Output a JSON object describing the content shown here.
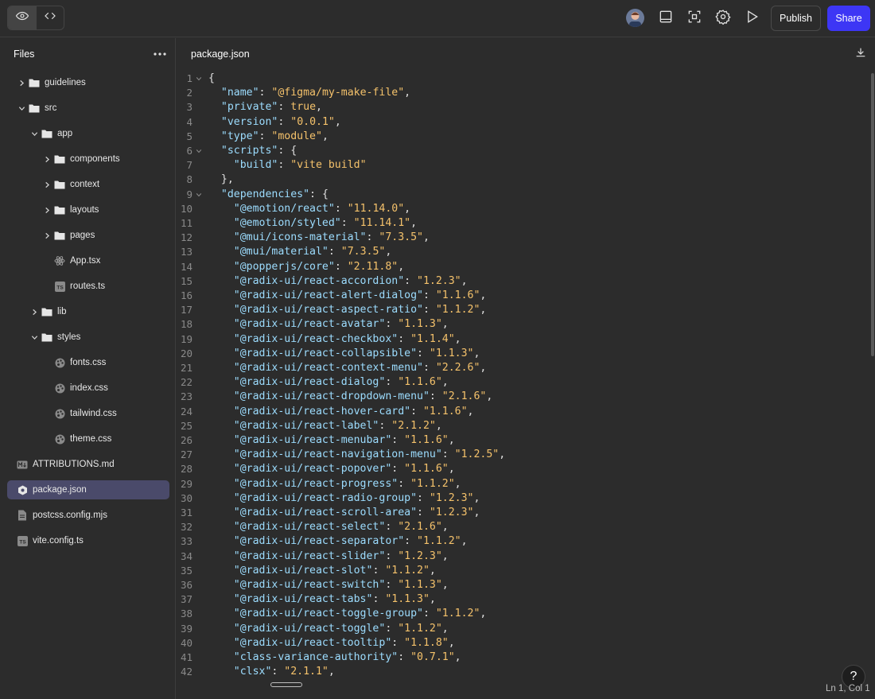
{
  "toolbar": {
    "publish_label": "Publish",
    "share_label": "Share"
  },
  "sidebar": {
    "title": "Files",
    "items": [
      {
        "label": "guidelines",
        "type": "folder",
        "depth": 1,
        "expanded": false
      },
      {
        "label": "src",
        "type": "folder",
        "depth": 1,
        "expanded": true
      },
      {
        "label": "app",
        "type": "folder",
        "depth": 2,
        "expanded": true
      },
      {
        "label": "components",
        "type": "folder",
        "depth": 3,
        "expanded": false
      },
      {
        "label": "context",
        "type": "folder",
        "depth": 3,
        "expanded": false
      },
      {
        "label": "layouts",
        "type": "folder",
        "depth": 3,
        "expanded": false
      },
      {
        "label": "pages",
        "type": "folder",
        "depth": 3,
        "expanded": false
      },
      {
        "label": "App.tsx",
        "type": "react-file",
        "depth": 3
      },
      {
        "label": "routes.ts",
        "type": "ts-file",
        "depth": 3
      },
      {
        "label": "lib",
        "type": "folder",
        "depth": 2,
        "expanded": false
      },
      {
        "label": "styles",
        "type": "folder",
        "depth": 2,
        "expanded": true
      },
      {
        "label": "fonts.css",
        "type": "css-file",
        "depth": 3
      },
      {
        "label": "index.css",
        "type": "css-file",
        "depth": 3
      },
      {
        "label": "tailwind.css",
        "type": "css-file",
        "depth": 3
      },
      {
        "label": "theme.css",
        "type": "css-file",
        "depth": 3
      },
      {
        "label": "ATTRIBUTIONS.md",
        "type": "md-file",
        "depth": 1
      },
      {
        "label": "package.json",
        "type": "json-file",
        "depth": 1,
        "selected": true
      },
      {
        "label": "postcss.config.mjs",
        "type": "file",
        "depth": 1
      },
      {
        "label": "vite.config.ts",
        "type": "ts-file",
        "depth": 1
      }
    ]
  },
  "editor": {
    "tab": "package.json",
    "status": "Ln 1, Col 1",
    "help": "?",
    "lines": [
      {
        "n": "1",
        "fold": true,
        "indent": "",
        "key": "",
        "sep": "",
        "value": "",
        "tail": "{"
      },
      {
        "n": "2",
        "indent": "  ",
        "key": "\"name\"",
        "sep": ": ",
        "value": "\"@figma/my-make-file\"",
        "tail": ","
      },
      {
        "n": "3",
        "indent": "  ",
        "key": "\"private\"",
        "sep": ": ",
        "value": "true",
        "tail": ","
      },
      {
        "n": "4",
        "indent": "  ",
        "key": "\"version\"",
        "sep": ": ",
        "value": "\"0.0.1\"",
        "tail": ","
      },
      {
        "n": "5",
        "indent": "  ",
        "key": "\"type\"",
        "sep": ": ",
        "value": "\"module\"",
        "tail": ","
      },
      {
        "n": "6",
        "fold": true,
        "indent": "  ",
        "key": "\"scripts\"",
        "sep": ": ",
        "value": "",
        "tail": "{"
      },
      {
        "n": "7",
        "indent": "    ",
        "key": "\"build\"",
        "sep": ": ",
        "value": "\"vite build\"",
        "tail": ""
      },
      {
        "n": "8",
        "indent": "  ",
        "key": "",
        "sep": "",
        "value": "",
        "tail": "},"
      },
      {
        "n": "9",
        "fold": true,
        "indent": "  ",
        "key": "\"dependencies\"",
        "sep": ": ",
        "value": "",
        "tail": "{"
      },
      {
        "n": "10",
        "indent": "    ",
        "key": "\"@emotion/react\"",
        "sep": ": ",
        "value": "\"11.14.0\"",
        "tail": ","
      },
      {
        "n": "11",
        "indent": "    ",
        "key": "\"@emotion/styled\"",
        "sep": ": ",
        "value": "\"11.14.1\"",
        "tail": ","
      },
      {
        "n": "12",
        "indent": "    ",
        "key": "\"@mui/icons-material\"",
        "sep": ": ",
        "value": "\"7.3.5\"",
        "tail": ","
      },
      {
        "n": "13",
        "indent": "    ",
        "key": "\"@mui/material\"",
        "sep": ": ",
        "value": "\"7.3.5\"",
        "tail": ","
      },
      {
        "n": "14",
        "indent": "    ",
        "key": "\"@popperjs/core\"",
        "sep": ": ",
        "value": "\"2.11.8\"",
        "tail": ","
      },
      {
        "n": "15",
        "indent": "    ",
        "key": "\"@radix-ui/react-accordion\"",
        "sep": ": ",
        "value": "\"1.2.3\"",
        "tail": ","
      },
      {
        "n": "16",
        "indent": "    ",
        "key": "\"@radix-ui/react-alert-dialog\"",
        "sep": ": ",
        "value": "\"1.1.6\"",
        "tail": ","
      },
      {
        "n": "17",
        "indent": "    ",
        "key": "\"@radix-ui/react-aspect-ratio\"",
        "sep": ": ",
        "value": "\"1.1.2\"",
        "tail": ","
      },
      {
        "n": "18",
        "indent": "    ",
        "key": "\"@radix-ui/react-avatar\"",
        "sep": ": ",
        "value": "\"1.1.3\"",
        "tail": ","
      },
      {
        "n": "19",
        "indent": "    ",
        "key": "\"@radix-ui/react-checkbox\"",
        "sep": ": ",
        "value": "\"1.1.4\"",
        "tail": ","
      },
      {
        "n": "20",
        "indent": "    ",
        "key": "\"@radix-ui/react-collapsible\"",
        "sep": ": ",
        "value": "\"1.1.3\"",
        "tail": ","
      },
      {
        "n": "21",
        "indent": "    ",
        "key": "\"@radix-ui/react-context-menu\"",
        "sep": ": ",
        "value": "\"2.2.6\"",
        "tail": ","
      },
      {
        "n": "22",
        "indent": "    ",
        "key": "\"@radix-ui/react-dialog\"",
        "sep": ": ",
        "value": "\"1.1.6\"",
        "tail": ","
      },
      {
        "n": "23",
        "indent": "    ",
        "key": "\"@radix-ui/react-dropdown-menu\"",
        "sep": ": ",
        "value": "\"2.1.6\"",
        "tail": ","
      },
      {
        "n": "24",
        "indent": "    ",
        "key": "\"@radix-ui/react-hover-card\"",
        "sep": ": ",
        "value": "\"1.1.6\"",
        "tail": ","
      },
      {
        "n": "25",
        "indent": "    ",
        "key": "\"@radix-ui/react-label\"",
        "sep": ": ",
        "value": "\"2.1.2\"",
        "tail": ","
      },
      {
        "n": "26",
        "indent": "    ",
        "key": "\"@radix-ui/react-menubar\"",
        "sep": ": ",
        "value": "\"1.1.6\"",
        "tail": ","
      },
      {
        "n": "27",
        "indent": "    ",
        "key": "\"@radix-ui/react-navigation-menu\"",
        "sep": ": ",
        "value": "\"1.2.5\"",
        "tail": ","
      },
      {
        "n": "28",
        "indent": "    ",
        "key": "\"@radix-ui/react-popover\"",
        "sep": ": ",
        "value": "\"1.1.6\"",
        "tail": ","
      },
      {
        "n": "29",
        "indent": "    ",
        "key": "\"@radix-ui/react-progress\"",
        "sep": ": ",
        "value": "\"1.1.2\"",
        "tail": ","
      },
      {
        "n": "30",
        "indent": "    ",
        "key": "\"@radix-ui/react-radio-group\"",
        "sep": ": ",
        "value": "\"1.2.3\"",
        "tail": ","
      },
      {
        "n": "31",
        "indent": "    ",
        "key": "\"@radix-ui/react-scroll-area\"",
        "sep": ": ",
        "value": "\"1.2.3\"",
        "tail": ","
      },
      {
        "n": "32",
        "indent": "    ",
        "key": "\"@radix-ui/react-select\"",
        "sep": ": ",
        "value": "\"2.1.6\"",
        "tail": ","
      },
      {
        "n": "33",
        "indent": "    ",
        "key": "\"@radix-ui/react-separator\"",
        "sep": ": ",
        "value": "\"1.1.2\"",
        "tail": ","
      },
      {
        "n": "34",
        "indent": "    ",
        "key": "\"@radix-ui/react-slider\"",
        "sep": ": ",
        "value": "\"1.2.3\"",
        "tail": ","
      },
      {
        "n": "35",
        "indent": "    ",
        "key": "\"@radix-ui/react-slot\"",
        "sep": ": ",
        "value": "\"1.1.2\"",
        "tail": ","
      },
      {
        "n": "36",
        "indent": "    ",
        "key": "\"@radix-ui/react-switch\"",
        "sep": ": ",
        "value": "\"1.1.3\"",
        "tail": ","
      },
      {
        "n": "37",
        "indent": "    ",
        "key": "\"@radix-ui/react-tabs\"",
        "sep": ": ",
        "value": "\"1.1.3\"",
        "tail": ","
      },
      {
        "n": "38",
        "indent": "    ",
        "key": "\"@radix-ui/react-toggle-group\"",
        "sep": ": ",
        "value": "\"1.1.2\"",
        "tail": ","
      },
      {
        "n": "39",
        "indent": "    ",
        "key": "\"@radix-ui/react-toggle\"",
        "sep": ": ",
        "value": "\"1.1.2\"",
        "tail": ","
      },
      {
        "n": "40",
        "indent": "    ",
        "key": "\"@radix-ui/react-tooltip\"",
        "sep": ": ",
        "value": "\"1.1.8\"",
        "tail": ","
      },
      {
        "n": "41",
        "indent": "    ",
        "key": "\"class-variance-authority\"",
        "sep": ": ",
        "value": "\"0.7.1\"",
        "tail": ","
      },
      {
        "n": "42",
        "indent": "    ",
        "key": "\"clsx\"",
        "sep": ": ",
        "value": "\"2.1.1\"",
        "tail": ","
      }
    ]
  },
  "colors": {
    "background": "#2c2c2c",
    "accent": "#3d36f5",
    "selected_row": "#4a4a6a",
    "json_key": "#9cdcfe",
    "json_value": "#f5c26b"
  }
}
